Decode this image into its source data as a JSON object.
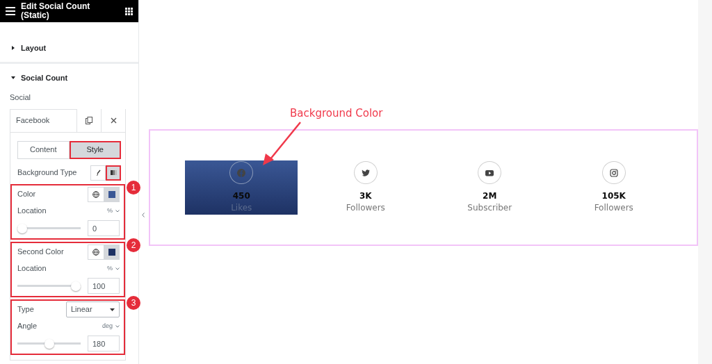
{
  "header": {
    "title": "Edit Social Count (Static)"
  },
  "sections": [
    {
      "label": "Layout",
      "expanded": false
    },
    {
      "label": "Social Count",
      "expanded": true
    }
  ],
  "repeater": {
    "label": "Social",
    "item_title": "Facebook",
    "tabs": [
      {
        "label": "Content",
        "selected": false,
        "annotated": false
      },
      {
        "label": "Style",
        "selected": true,
        "annotated": true
      }
    ],
    "background_type": {
      "label": "Background Type",
      "options": [
        {
          "kind": "classic",
          "selected": false,
          "annotated": false
        },
        {
          "kind": "gradient",
          "selected": true,
          "annotated": true
        }
      ]
    },
    "groups": [
      {
        "kind": "color",
        "callout": "1",
        "label": "Color",
        "color": "#3a5795",
        "location_label": "Location",
        "unit": "%",
        "level": 0,
        "value": "0"
      },
      {
        "kind": "color",
        "callout": "2",
        "label": "Second Color",
        "color": "#1e3264",
        "location_label": "Location",
        "unit": "%",
        "level": 1,
        "value": "100"
      },
      {
        "kind": "type",
        "callout": "3",
        "label": "Type",
        "select": "Linear",
        "angle_label": "Angle",
        "unit": "deg",
        "level": 0.5,
        "value": "180"
      }
    ]
  },
  "annotation": {
    "text": "Background Color"
  },
  "social_items": [
    {
      "kind": "facebook",
      "count": "450",
      "label": "Likes",
      "highlighted": true
    },
    {
      "kind": "twitter",
      "count": "3K",
      "label": "Followers",
      "highlighted": false
    },
    {
      "kind": "youtube",
      "count": "2M",
      "label": "Subscriber",
      "highlighted": false
    },
    {
      "kind": "instagram",
      "count": "105K",
      "label": "Followers",
      "highlighted": false
    }
  ]
}
